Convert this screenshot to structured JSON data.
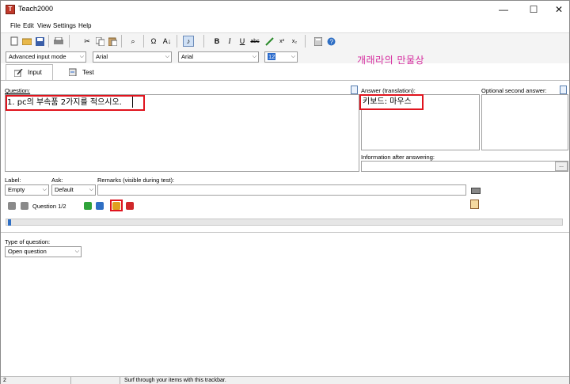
{
  "window": {
    "title": "Teach2000",
    "app_icon_letter": "T",
    "minimize": "—",
    "maximize": "☐",
    "close": "✕"
  },
  "menu": [
    {
      "label": "File"
    },
    {
      "label": "Edit"
    },
    {
      "label": "View"
    },
    {
      "label": "Settings"
    },
    {
      "label": "Help"
    }
  ],
  "toolbar": {
    "bold": "B",
    "italic": "I",
    "underline": "U",
    "strike": "abc",
    "superscript": "x²",
    "subscript": "x₂",
    "omega": "Ω",
    "sort": "A↓",
    "binoculars": "⌕",
    "music": "♪"
  },
  "combos": {
    "input_mode": "Advanced input mode",
    "font_question": "Arial",
    "font_answer": "Arial",
    "color_size": "12"
  },
  "handwritten_note": "개래라의 만물상",
  "tabs": [
    {
      "label": "Input",
      "active": true
    },
    {
      "label": "Test",
      "active": false
    }
  ],
  "question": {
    "label": "Question:",
    "value": "1. pc의 부속품 2가지를 적으시오."
  },
  "answer": {
    "label": "Answer (translation):",
    "value": "키보드: 마우스"
  },
  "second_answer": {
    "label": "Optional second answer:"
  },
  "info_after": {
    "label": "Information after answering:",
    "button": "..."
  },
  "meta": {
    "label_label": "Label:",
    "label_value": "Empty",
    "ask_label": "Ask:",
    "ask_value": "Default",
    "remarks_label": "Remarks (visible during test):",
    "remarks_value": ""
  },
  "nav": {
    "position": "Question 1/2"
  },
  "type_of_question": {
    "label": "Type of question:",
    "value": "Open question"
  },
  "status": {
    "count": "2",
    "hint": "Surf through your items with this trackbar."
  }
}
